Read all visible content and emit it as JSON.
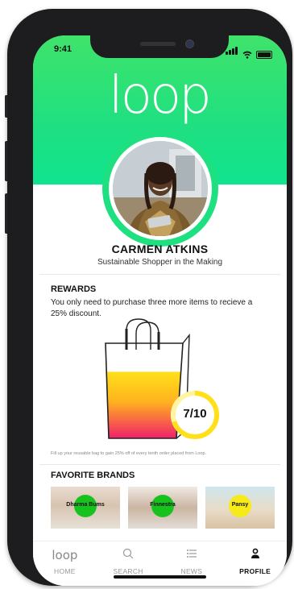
{
  "status": {
    "time": "9:41"
  },
  "brand": {
    "logo_text": "loop",
    "accent_color": "#1fe081"
  },
  "profile": {
    "name": "CARMEN ATKINS",
    "subtitle": "Sustainable Shopper in the Making"
  },
  "rewards": {
    "title": "REWARDS",
    "description": "You only need to purchase three more items to recieve a 25% discount.",
    "progress_label": "7/10",
    "progress_fraction": 0.7,
    "footnote": "Fill up your reusable bag to gain 25% off of every tenth order placed from Loop."
  },
  "favorite_brands": {
    "title": "FAVORITE BRANDS",
    "items": [
      {
        "name": "Dharma Bums",
        "dot_color": "#17c21f"
      },
      {
        "name": "Finnestra",
        "dot_color": "#17c21f"
      },
      {
        "name": "Pansy",
        "dot_color": "#f7ea1a"
      }
    ]
  },
  "tabs": [
    {
      "label": "HOME",
      "icon": "loop-logo-icon"
    },
    {
      "label": "SEARCH",
      "icon": "search-icon"
    },
    {
      "label": "NEWS",
      "icon": "list-icon"
    },
    {
      "label": "PROFILE",
      "icon": "profile-icon",
      "active": true
    }
  ]
}
